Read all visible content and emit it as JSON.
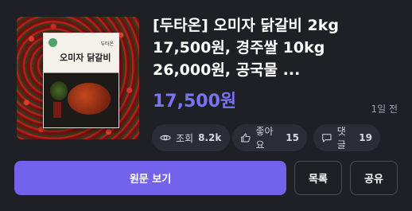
{
  "product": {
    "title": "[두타온] 오미자 닭갈비 2kg\n17,500원, 경주쌀 10kg\n26,000원, 공국물 ...",
    "price": "17,500원",
    "posted_time": "1일 전",
    "thumbnail": {
      "brand_text": "두타온",
      "package_title": "오미자 닭갈비"
    }
  },
  "stats": {
    "views_label": "조회",
    "views_value": "8.2k",
    "likes_label": "좋아요",
    "likes_value": "15",
    "comments_label": "댓글",
    "comments_value": "19"
  },
  "actions": {
    "view_original": "원문 보기",
    "list": "목록",
    "share": "공유"
  },
  "colors": {
    "background": "#1f2026",
    "accent": "#7263ea",
    "price": "#7b73f1",
    "chip": "#2b2d36"
  },
  "icons": {
    "views": "eye-icon",
    "likes": "thumbs-up-icon",
    "comments": "comment-icon"
  }
}
